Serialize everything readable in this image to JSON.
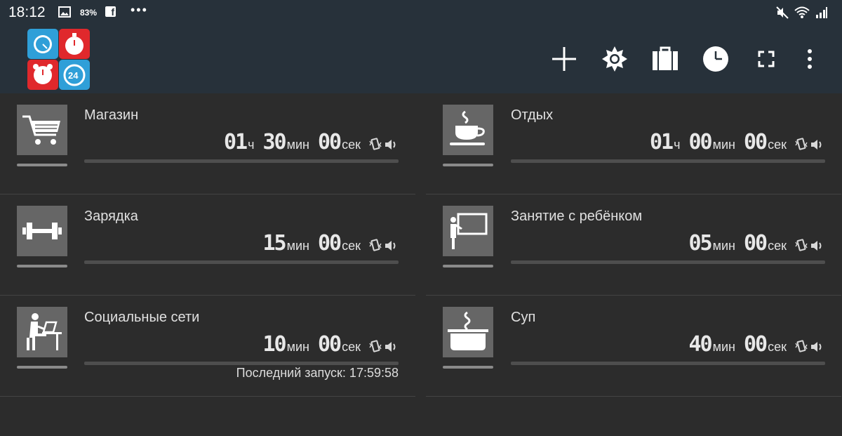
{
  "status_bar": {
    "time": "18:12",
    "battery": "83%",
    "facebook_glyph": "f",
    "more": "•••"
  },
  "timers": [
    {
      "title": "Магазин",
      "icon": "shopping-cart-icon",
      "h": "01",
      "h_unit": "ч",
      "m": "30",
      "m_unit": "мин",
      "s": "00",
      "s_unit": "сек"
    },
    {
      "title": "Отдых",
      "icon": "coffee-cup-icon",
      "h": "01",
      "h_unit": "ч",
      "m": "00",
      "m_unit": "мин",
      "s": "00",
      "s_unit": "сек"
    },
    {
      "title": "Зарядка",
      "icon": "dumbbell-icon",
      "m": "15",
      "m_unit": "мин",
      "s": "00",
      "s_unit": "сек"
    },
    {
      "title": "Занятие с ребёнком",
      "icon": "teacher-board-icon",
      "m": "05",
      "m_unit": "мин",
      "s": "00",
      "s_unit": "сек"
    },
    {
      "title": "Социальные сети",
      "icon": "person-laptop-icon",
      "m": "10",
      "m_unit": "мин",
      "s": "00",
      "s_unit": "сек",
      "last_launch": "Последний запуск: 17:59:58"
    },
    {
      "title": "Суп",
      "icon": "soup-pot-icon",
      "m": "40",
      "m_unit": "мин",
      "s": "00",
      "s_unit": "сек"
    }
  ],
  "colors": {
    "appbar": "#27313a",
    "background": "#2c2c2c",
    "tile": "#666666"
  }
}
